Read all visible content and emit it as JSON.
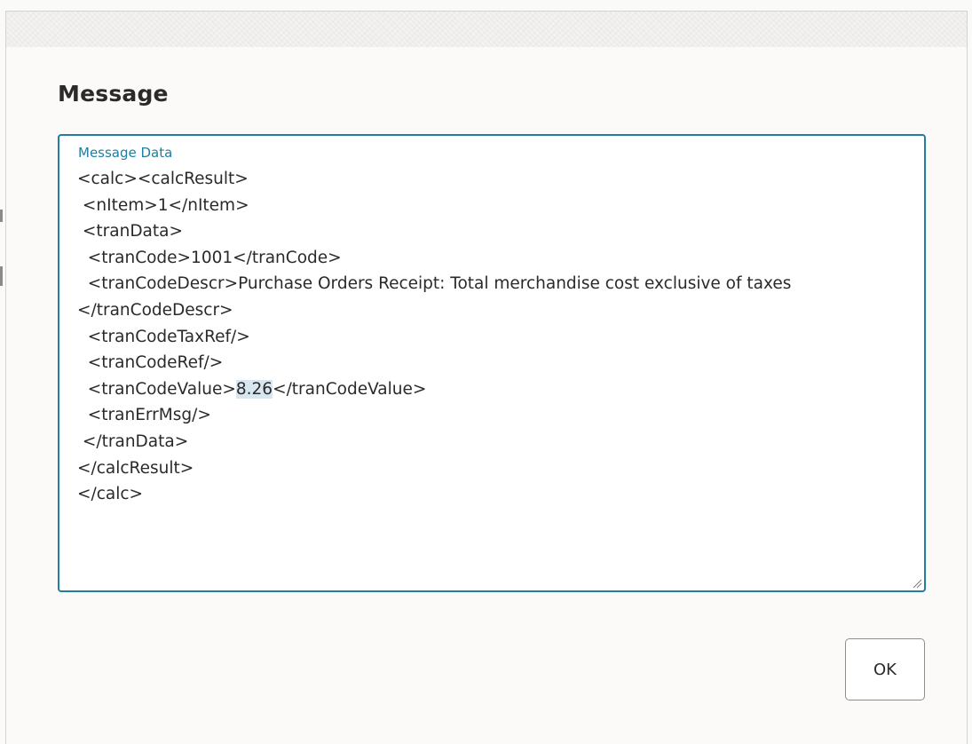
{
  "dialog": {
    "title": "Message",
    "field": {
      "label": "Message Data",
      "value_before_highlight": "<calc><calcResult>\n <nItem>1</nItem>\n <tranData>\n  <tranCode>1001</tranCode>\n  <tranCodeDescr>Purchase Orders Receipt: Total merchandise cost exclusive of taxes </tranCodeDescr>\n  <tranCodeTaxRef/>\n  <tranCodeRef/>\n  <tranCodeValue>",
      "value_highlighted": "8.26",
      "value_after_highlight": "</tranCodeValue>\n  <tranErrMsg/>\n </tranData>\n</calcResult>\n</calc>"
    },
    "ok_label": "OK"
  },
  "colors": {
    "accent": "#227e9e",
    "text": "#2b2a28",
    "selection": "#d8e6f0",
    "dialog_background": "#fbfaf9"
  },
  "icons": {
    "resize_grip": "resize-grip-icon"
  }
}
